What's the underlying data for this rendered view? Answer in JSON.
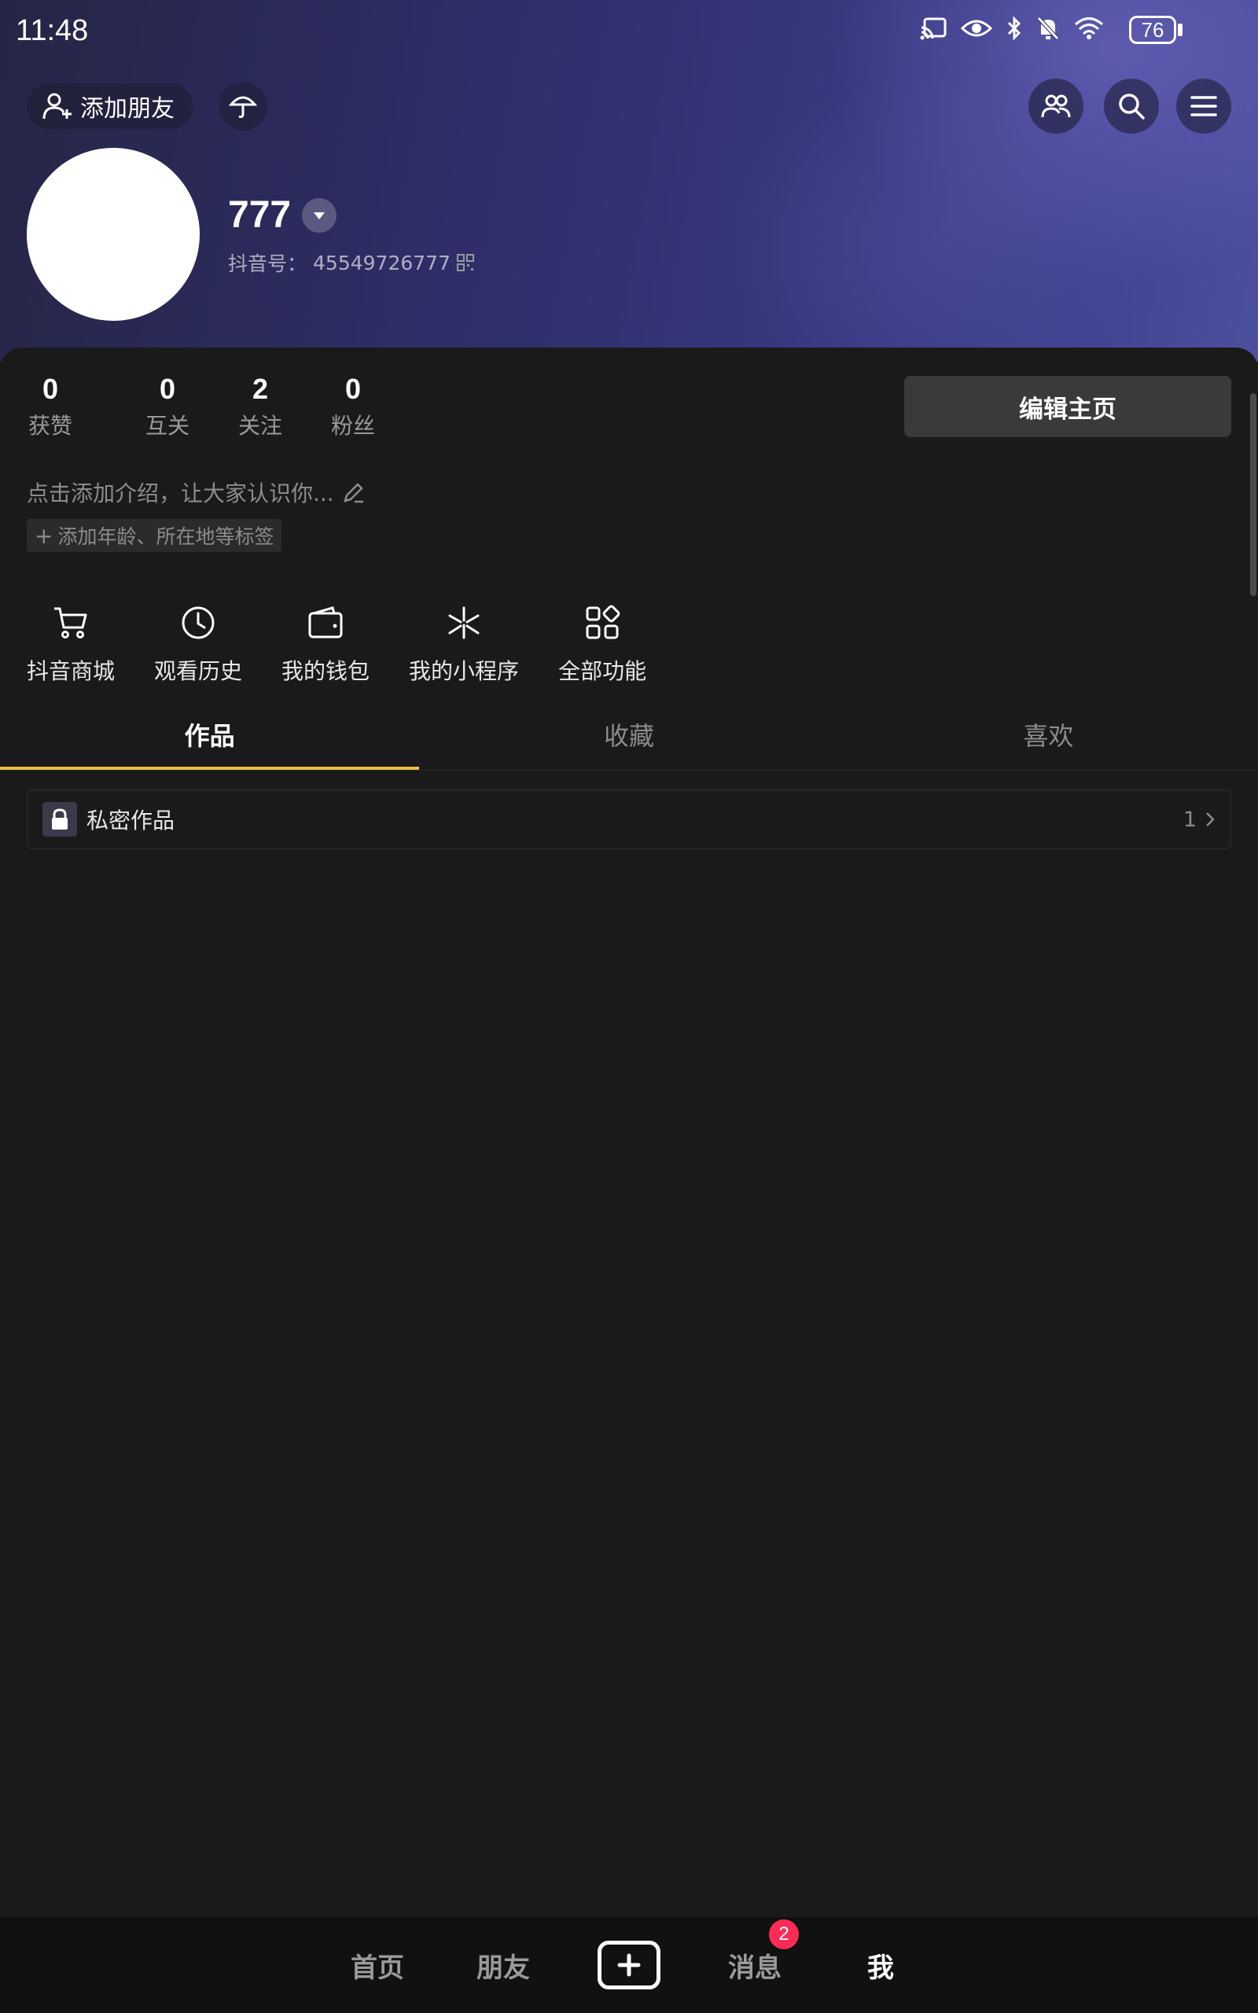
{
  "status_bar": {
    "time": "11:48",
    "battery": "76"
  },
  "header": {
    "add_friend_label": "添加朋友"
  },
  "profile": {
    "username": "777",
    "douyin_id_label": "抖音号：",
    "douyin_id": "45549726777"
  },
  "stats": [
    {
      "value": "0",
      "label": "获赞"
    },
    {
      "value": "0",
      "label": "互关"
    },
    {
      "value": "2",
      "label": "关注"
    },
    {
      "value": "0",
      "label": "粉丝"
    }
  ],
  "edit_button_label": "编辑主页",
  "bio_placeholder": "点击添加介绍，让大家认识你...",
  "tag_button_label": "添加年龄、所在地等标签",
  "shortcuts": [
    {
      "label": "抖音商城",
      "icon": "cart-icon"
    },
    {
      "label": "观看历史",
      "icon": "clock-icon"
    },
    {
      "label": "我的钱包",
      "icon": "wallet-icon"
    },
    {
      "label": "我的小程序",
      "icon": "mini-program-icon"
    },
    {
      "label": "全部功能",
      "icon": "grid-icon"
    }
  ],
  "tabs": [
    {
      "label": "作品",
      "active": true
    },
    {
      "label": "收藏",
      "active": false
    },
    {
      "label": "喜欢",
      "active": false
    }
  ],
  "private_works": {
    "label": "私密作品",
    "count": "1"
  },
  "bottom_nav": {
    "home": "首页",
    "friends": "朋友",
    "messages": "消息",
    "messages_badge": "2",
    "me": "我"
  },
  "colors": {
    "tab_indicator": "#e8c04a",
    "badge": "#fe2c55",
    "background": "#1a1a1a"
  }
}
